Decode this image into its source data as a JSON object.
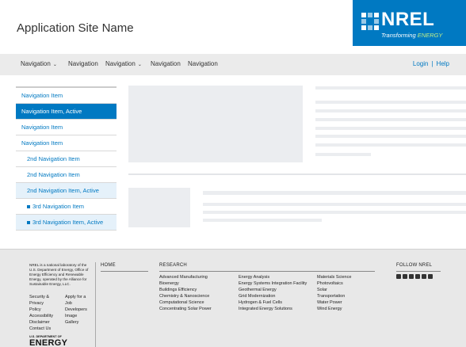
{
  "header": {
    "site_name": "Application Site Name",
    "logo": {
      "text": "NREL",
      "tagline_pre": "Transforming ",
      "tagline_accent": "ENERGY"
    }
  },
  "nav": {
    "items": [
      {
        "label": "Navigation",
        "has_dropdown": true
      },
      {
        "label": "Navigation",
        "has_dropdown": false
      },
      {
        "label": "Navigation",
        "has_dropdown": true
      },
      {
        "label": "Navigation",
        "has_dropdown": false
      },
      {
        "label": "Navigation",
        "has_dropdown": false
      }
    ],
    "login": "Login",
    "separator": "|",
    "help": "Help",
    "caret": "⌄"
  },
  "sidebar": {
    "items": [
      {
        "label": "Navigation Item",
        "level": 1,
        "active": false
      },
      {
        "label": "Navigation Item, Active",
        "level": 1,
        "active": true
      },
      {
        "label": "Navigation Item",
        "level": 1,
        "active": false
      },
      {
        "label": "Navigation Item",
        "level": 1,
        "active": false
      },
      {
        "label": "2nd Navigation Item",
        "level": 2,
        "active": false
      },
      {
        "label": "2nd Navigation Item",
        "level": 2,
        "active": false
      },
      {
        "label": "2nd Navigation Item, Active",
        "level": 2,
        "active": true
      },
      {
        "label": "3rd Navigation Item",
        "level": 3,
        "active": false
      },
      {
        "label": "3rd Navigation Item, Active",
        "level": 3,
        "active": true
      }
    ]
  },
  "footer": {
    "about": "NREL is a national laboratory of the U.S. Department of Energy, Office of Energy Efficiency and Renewable Energy, operated by the Alliance for Sustainable Energy, LLC.",
    "links_col1": [
      "Security &",
      "Privacy",
      "Policy",
      "Accessibility",
      "Disclaimer",
      "Contact Us"
    ],
    "links_col2": [
      "Apply for a",
      "Job",
      "Developers",
      "Image",
      "Gallery"
    ],
    "doe_small": "U.S. DEPARTMENT OF",
    "doe_big": "ENERGY",
    "home_heading": "HOME",
    "research_heading": "RESEARCH",
    "research_col1": [
      "Advanced Manufacturing",
      "Bioenergy",
      "Buildings Efficiency",
      "Chemistry & Nanoscience",
      "Computational Science",
      "Concentrating Solar Power"
    ],
    "research_col2": [
      "Energy Analysis",
      "Energy Systems Integration Facility",
      "Geothermal Energy",
      "Grid Modernization",
      "Hydrogen & Fuel Cells",
      "Integrated Energy Solutions"
    ],
    "research_col3": [
      "Materials Science",
      "Photovoltaics",
      "Solar",
      "Transportation",
      "Water Power",
      "Wind Energy"
    ],
    "follow_heading": "FOLLOW NREL",
    "social_icons": [
      "facebook-icon",
      "email-icon",
      "twitter-icon",
      "youtube-icon",
      "linkedin-icon",
      "instagram-icon"
    ]
  },
  "colors": {
    "brand": "#0079c2",
    "accent": "#c1ee86",
    "active_bg": "#e5f1fa",
    "placeholder": "#ebedf0"
  }
}
